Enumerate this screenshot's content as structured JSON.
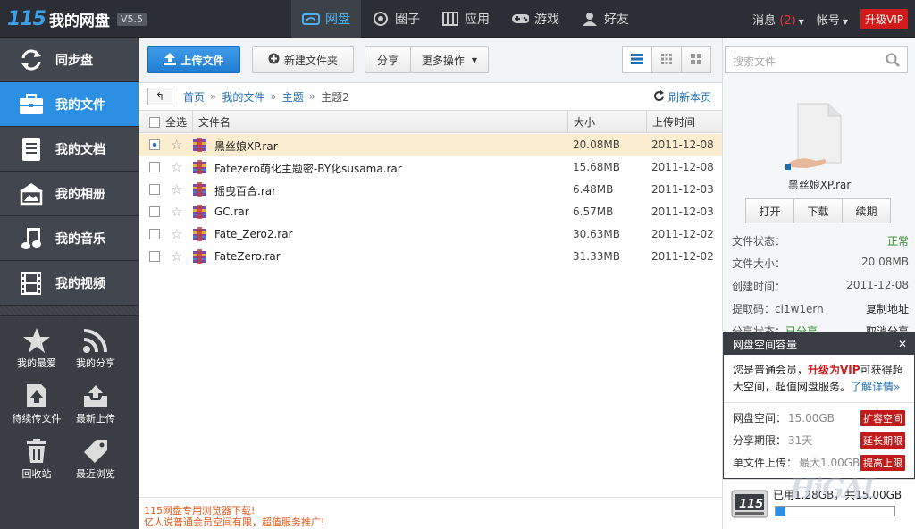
{
  "app": {
    "logo_num": "115",
    "logo_name": "我的网盘",
    "version": "V5.5"
  },
  "nav": {
    "tabs": [
      {
        "label": "网盘",
        "icon": "cloud-icon"
      },
      {
        "label": "圈子",
        "icon": "circle-icon"
      },
      {
        "label": "应用",
        "icon": "apps-icon"
      },
      {
        "label": "游戏",
        "icon": "gamepad-icon"
      },
      {
        "label": "好友",
        "icon": "friends-icon"
      }
    ]
  },
  "topright": {
    "messages": "消息",
    "msg_count": "(2)",
    "account": "帐号",
    "vip": "升级VIP"
  },
  "sidebar": {
    "items": [
      {
        "label": "同步盘",
        "icon": "sync-icon"
      },
      {
        "label": "我的文件",
        "icon": "briefcase-icon"
      },
      {
        "label": "我的文档",
        "icon": "document-icon"
      },
      {
        "label": "我的相册",
        "icon": "photo-icon"
      },
      {
        "label": "我的音乐",
        "icon": "music-icon"
      },
      {
        "label": "我的视频",
        "icon": "film-icon"
      }
    ],
    "tools": [
      {
        "label": "我的最爱",
        "icon": "star-icon"
      },
      {
        "label": "我的分享",
        "icon": "rss-icon"
      },
      {
        "label": "待续传文件",
        "icon": "upload-resume-icon"
      },
      {
        "label": "最新上传",
        "icon": "inbox-upload-icon"
      },
      {
        "label": "回收站",
        "icon": "trash-icon"
      },
      {
        "label": "最近浏览",
        "icon": "tag-icon"
      }
    ]
  },
  "toolbar": {
    "upload": "上传文件",
    "new_folder": "新建文件夹",
    "share": "分享",
    "more": "更多操作"
  },
  "breadcrumb": {
    "items": [
      "首页",
      "我的文件",
      "主题",
      "主题2"
    ],
    "refresh": "刷新本页"
  },
  "table": {
    "select_all": "全选",
    "headers": {
      "name": "文件名",
      "size": "大小",
      "date": "上传时间"
    },
    "rows": [
      {
        "name": "黑丝娘XP.rar",
        "size": "20.08MB",
        "date": "2011-12-08"
      },
      {
        "name": "Fatezero萌化主题密-BY化susama.rar",
        "size": "15.68MB",
        "date": "2011-12-08"
      },
      {
        "name": "摇曳百合.rar",
        "size": "6.48MB",
        "date": "2011-12-03"
      },
      {
        "name": "GC.rar",
        "size": "6.57MB",
        "date": "2011-12-03"
      },
      {
        "name": "Fate_Zero2.rar",
        "size": "30.63MB",
        "date": "2011-12-02"
      },
      {
        "name": "FateZero.rar",
        "size": "31.33MB",
        "date": "2011-12-02"
      }
    ]
  },
  "bottom_note": {
    "line1": "115网盘专用浏览器下载!",
    "line2": "亿人说普通会员空间有限，超值服务推广!"
  },
  "detail": {
    "search_placeholder": "搜索文件",
    "filename": "黑丝娘XP.rar",
    "actions": [
      "打开",
      "下载",
      "续期"
    ],
    "status_label": "文件状态：",
    "status_value": "正常",
    "size_label": "文件大小：",
    "size_value": "20.08MB",
    "created_label": "创建时间：",
    "created_value": "2011-12-08",
    "code_label": "提取码：",
    "code_value": "cl1w1ern",
    "copy_link": "复制地址",
    "share_label": "分享状态：",
    "share_value": "已分享",
    "cancel_share": "取消分享"
  },
  "popup": {
    "title": "网盘空间容量",
    "text_a": "您是普通会员，",
    "text_vip": "升级为VIP",
    "text_b": "可获得超大空间，超值网盘服务。",
    "more": "了解详情»",
    "rows": [
      {
        "label": "网盘空间：",
        "value": "15.00GB",
        "button": "扩容空间"
      },
      {
        "label": "分享期限：",
        "value": "31天",
        "button": "延长期限"
      },
      {
        "label": "单文件上传：",
        "value": "最大1.00GB",
        "button": "提高上限"
      }
    ]
  },
  "storage": {
    "text": "已用1.28GB，共15.00GB",
    "used_fraction": 0.085
  },
  "watermark": "HiGAL"
}
